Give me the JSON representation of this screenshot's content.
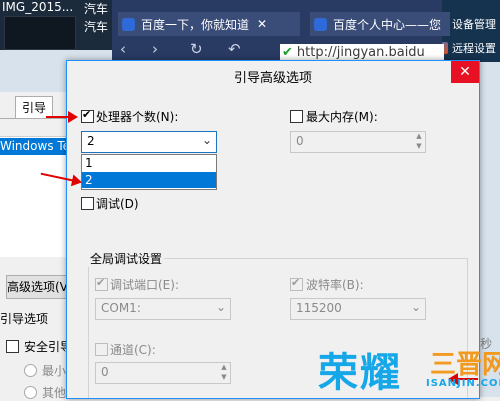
{
  "desktop": {
    "file_name": "IMG_2015...",
    "item_a": "汽车",
    "item_b": "汽车",
    "right_items": [
      "设备管理",
      "远程设置"
    ]
  },
  "browser": {
    "tabs": [
      {
        "label": "百度一下，你就知道",
        "close": "✕"
      },
      {
        "label": "百度个人中心——您",
        "close": ""
      }
    ],
    "nav": {
      "back": "‹",
      "forward": "›",
      "refresh": "↻",
      "undo": "↶"
    },
    "url": "http://jingyan.baidu"
  },
  "behind_window": {
    "tab_label": "引导",
    "list_item": "Windows Tech",
    "advanced_button": "高级选项(V)...",
    "group_label": "引导选项",
    "safe_boot": "安全引导(",
    "minimal": "最小(M",
    "other": "其他外"
  },
  "dialog": {
    "title": "引导高级选项",
    "close_icon": "✕",
    "processor_count": {
      "label": "处理器个数(N):",
      "checked": true,
      "value": "2",
      "options": [
        "1",
        "2"
      ],
      "selected_index": 1
    },
    "max_memory": {
      "label": "最大内存(M):",
      "checked": false,
      "value": "0"
    },
    "debug": {
      "label": "调试(D)",
      "checked": false
    },
    "global_debug": {
      "title": "全局调试设置",
      "debug_port": {
        "label": "调试端口(E):",
        "checked": true,
        "value": "COM1:"
      },
      "baud_rate": {
        "label": "波特率(B):",
        "checked": true,
        "value": "115200"
      },
      "channel": {
        "label": "通道(C):",
        "checked": false,
        "value": "0"
      }
    }
  },
  "watermark": {
    "main": "荣耀",
    "sub": "三晋网",
    "url": "ISANJIN.COM",
    "edge": "秒"
  },
  "colors": {
    "accent": "#0078d7",
    "close_red": "#e81123",
    "arrow_red": "#e00000",
    "watermark_blue": "#16a7e8",
    "watermark_orange": "#f29a1f"
  }
}
